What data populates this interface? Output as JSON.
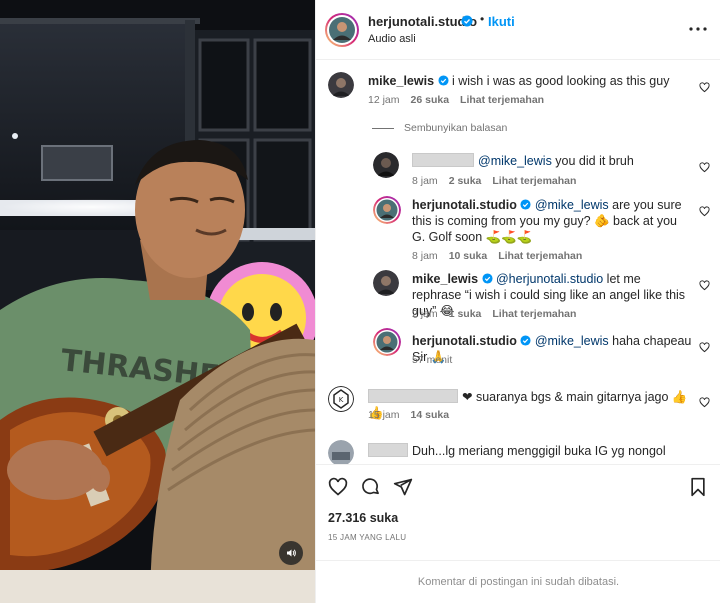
{
  "post": {
    "author": "herjunotali.studio",
    "follow_label": "Ikuti",
    "dot": "•",
    "audio": "Audio asli",
    "likes": "27.316 suka",
    "posted_ago": "15 JAM YANG LALU",
    "comments_closed": "Komentar di postingan ini sudah dibatasi."
  },
  "comments": [
    {
      "user": "mike_lewis",
      "text": "i wish i was as good looking as this guy",
      "time": "12 jam",
      "likes": "26 suka",
      "translate": "Lihat terjemahan",
      "hide_replies": "Sembunyikan balasan",
      "replies": [
        {
          "user": "",
          "mention": "@mike_lewis",
          "text": " you did it bruh",
          "time": "8 jam",
          "likes": "2 suka",
          "translate": "Lihat terjemahan"
        },
        {
          "user": "herjunotali.studio",
          "mention": "@mike_lewis",
          "text": " are you sure this is coming from you my guy? 🫵 back at you G. Golf soon ⛳⛳⛳",
          "time": "8 jam",
          "likes": "10 suka",
          "translate": "Lihat terjemahan"
        },
        {
          "user": "mike_lewis",
          "mention": "@herjunotali.studio",
          "text": " let me rephrase “i wish i could sing like an angel like this guy” 😂",
          "time": "2 jam",
          "likes": "1 suka",
          "translate": "Lihat terjemahan"
        },
        {
          "user": "herjunotali.studio",
          "mention": "@mike_lewis",
          "text": " haha chapeau Sir 🙏",
          "time": "57 menit"
        }
      ]
    },
    {
      "user": "",
      "text": "❤ suaranya bgs & main gitarnya jago 👍👍",
      "time": "15 jam",
      "likes": "14 suka"
    },
    {
      "user": "",
      "text": "Duh...lg meriang menggigil buka IG yg nongol"
    }
  ],
  "colors": {
    "link": "#0095f6",
    "verified": "#0095f6",
    "mention": "#00376b",
    "muted": "#737373"
  },
  "icons": [
    "verified-badge-icon",
    "more-icon",
    "heart-icon",
    "comment-icon",
    "share-icon",
    "bookmark-icon",
    "speaker-icon"
  ]
}
